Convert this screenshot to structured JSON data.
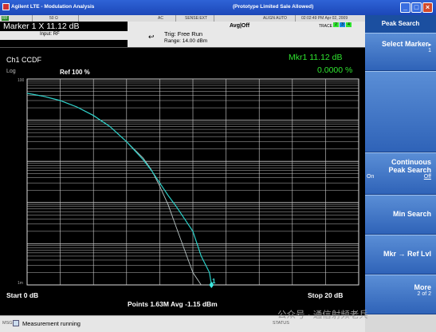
{
  "window": {
    "title": "Agilent LTE - Modulation Analysis",
    "center_title": "(Prototype   Limited Sale Allowed)"
  },
  "status_strip": {
    "rf": "RF",
    "ohm": "50 Ω",
    "ac": "AC",
    "sense": "SENSE:EXT",
    "align": "ALIGN AUTO",
    "datetime": "02:02:49 PM Apr 02, 2009",
    "trace_label": "TRACE",
    "trace_boxes": [
      "2",
      "3",
      "4"
    ]
  },
  "marker": {
    "readout": "Marker 1 X  11.12 dB",
    "input": "Input: RF"
  },
  "header": {
    "avg": "Avg|Off",
    "trig": "Trig: Free Run",
    "range": "Range: 14.00 dBm"
  },
  "plot": {
    "channel": "Ch1 CCDF",
    "log": "Log",
    "ref": "Ref 100  %",
    "mkr_label": "Mkr1  11.12 dB",
    "mkr_value": "0.0000 %",
    "y_top_tick": "100",
    "y_bottom_tick": "1m",
    "marker_num": "1",
    "start": "Start 0 dB",
    "stop": "Stop 20 dB",
    "points": "Points 1.63M   Avg -1.15 dBm"
  },
  "chart_data": {
    "type": "line",
    "xlim": [
      0,
      20
    ],
    "ylim": [
      0.001,
      100
    ],
    "yscale": "log",
    "series": [
      {
        "x": [
          0,
          1,
          2,
          3,
          4,
          5,
          6,
          7,
          7.5,
          8,
          8.5,
          9,
          9.5,
          10,
          10.5,
          11,
          11.12
        ],
        "values": [
          45,
          38,
          30,
          21,
          13,
          7,
          3,
          1.1,
          0.6,
          0.3,
          0.15,
          0.08,
          0.04,
          0.02,
          0.005,
          0.002,
          0.001
        ]
      },
      {
        "x": [
          0,
          1,
          2,
          3,
          4,
          5,
          6,
          7,
          7.5,
          8,
          8.5,
          9,
          9.5,
          10,
          10.5
        ],
        "values": [
          45,
          38,
          30,
          21,
          13,
          7,
          3,
          1.2,
          0.62,
          0.25,
          0.09,
          0.025,
          0.007,
          0.002,
          0.001
        ]
      }
    ],
    "colors": [
      "#2ad0c8",
      "#b9c4c4"
    ]
  },
  "softkeys": {
    "title": "Peak Search",
    "select_marker": "Select Marker",
    "select_marker_val": "1",
    "continuous_1": "Continuous",
    "continuous_2": "Peak Search",
    "on": "On",
    "off": "Off",
    "min_search": "Min Search",
    "mkr_ref": "Mkr → Ref Lvl",
    "more": "More",
    "more_sub": "2 of 2"
  },
  "statusbar": {
    "msg_tag": "MSG",
    "message": "Measurement running",
    "stat_tag": "STATUS"
  },
  "watermark": "公众号 · 通信射频老兵"
}
